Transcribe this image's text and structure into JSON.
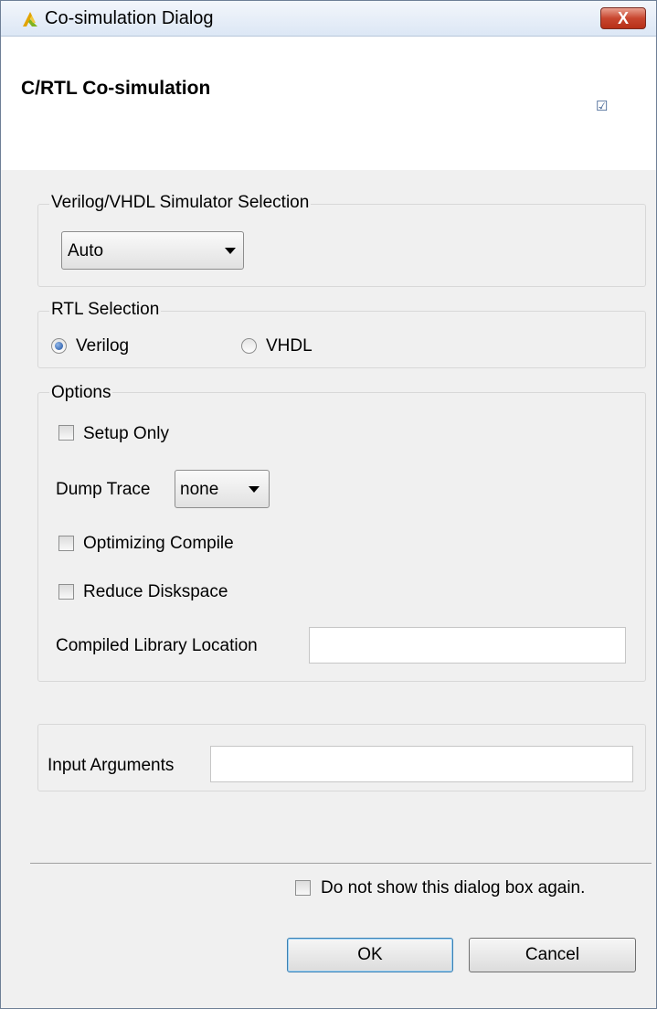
{
  "window": {
    "title": "Co-simulation Dialog",
    "close_label": "X"
  },
  "header": {
    "title": "C/RTL Co-simulation",
    "checkmark": "☑"
  },
  "simulator": {
    "legend": "Verilog/VHDL Simulator Selection",
    "selected": "Auto"
  },
  "rtl": {
    "legend": "RTL Selection",
    "options": [
      {
        "label": "Verilog",
        "selected": true
      },
      {
        "label": "VHDL",
        "selected": false
      }
    ]
  },
  "options": {
    "legend": "Options",
    "setup_only": {
      "label": "Setup Only",
      "checked": false
    },
    "dump_trace": {
      "label": "Dump Trace",
      "selected": "none"
    },
    "optimizing_compile": {
      "label": "Optimizing Compile",
      "checked": false
    },
    "reduce_diskspace": {
      "label": "Reduce Diskspace",
      "checked": false
    },
    "compiled_library": {
      "label": "Compiled Library Location",
      "value": ""
    }
  },
  "input_arguments": {
    "label": "Input Arguments",
    "value": ""
  },
  "footer": {
    "dont_show_label": "Do not show this dialog box again.",
    "dont_show_checked": false,
    "ok_label": "OK",
    "cancel_label": "Cancel"
  },
  "colors": {
    "title_bar": "#dce7f5",
    "close_button": "#c8462f",
    "dialog_bg": "#f0f0f0",
    "default_button_border": "#3c7fb1"
  },
  "icons": {
    "app": "xilinx-logo-icon",
    "close": "close-icon"
  }
}
